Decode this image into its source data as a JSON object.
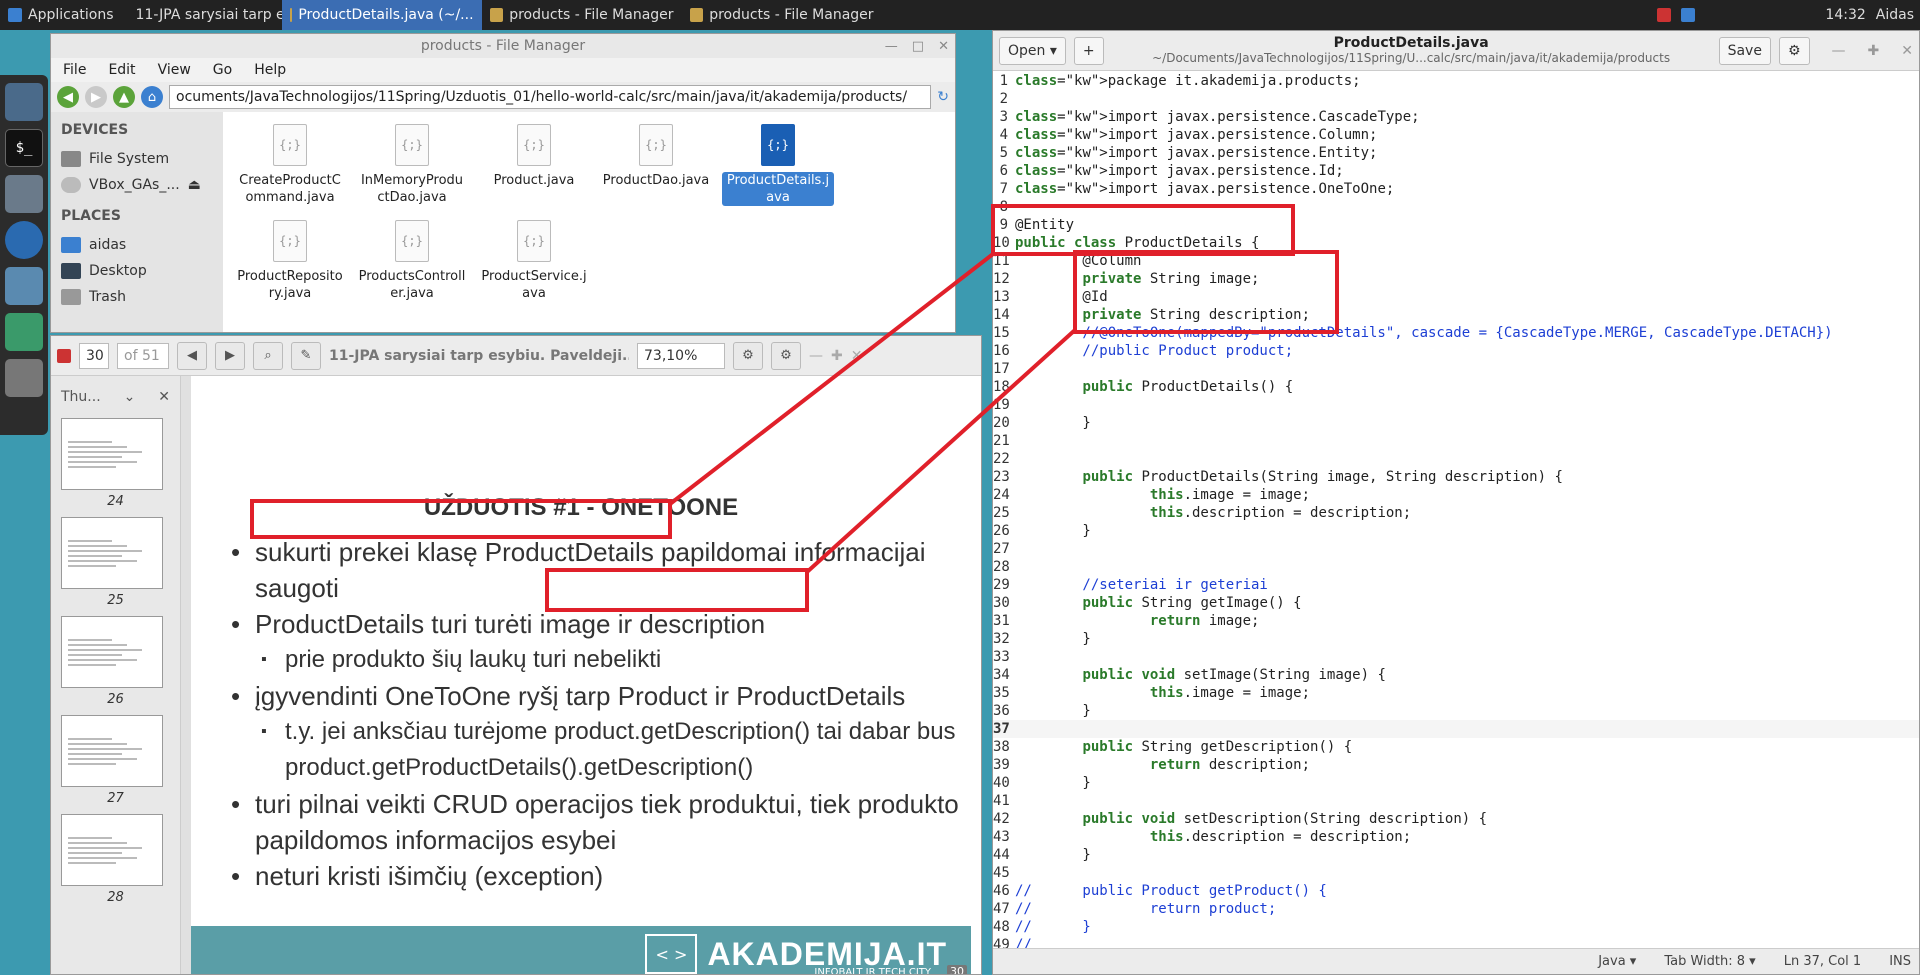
{
  "taskbar": {
    "apps_label": "Applications",
    "tasks": [
      {
        "label": "11-JPA sarysiai tarp es..."
      },
      {
        "label": "ProductDetails.java (~/..."
      },
      {
        "label": "products - File Manager"
      },
      {
        "label": "products - File Manager"
      }
    ],
    "clock": "14:32",
    "user": "Aidas"
  },
  "file_manager": {
    "title": "products - File Manager",
    "menu": [
      "File",
      "Edit",
      "View",
      "Go",
      "Help"
    ],
    "path": "ocuments/JavaTechnologijos/11Spring/Uzduotis_01/hello-world-calc/src/main/java/it/akademija/products/",
    "devices_head": "DEVICES",
    "devices": [
      "File System",
      "VBox_GAs_..."
    ],
    "places_head": "PLACES",
    "places": [
      "aidas",
      "Desktop",
      "Trash"
    ],
    "files": [
      "CreateProductCommand.java",
      "InMemoryProductDao.java",
      "Product.java",
      "ProductDao.java",
      "ProductDetails.java",
      "ProductRepository.java",
      "ProductsController.java",
      "ProductService.java"
    ],
    "selected_file": "ProductDetails.java"
  },
  "pdf_viewer": {
    "page_input": "30",
    "page_total": "of 51",
    "doc_title": "11-JPA sarysiai tarp esybiu. Paveldeji...",
    "zoom": "73,10%",
    "thumbs_label": "Thu...",
    "thumb_numbers": [
      "24",
      "25",
      "26",
      "27",
      "28"
    ],
    "slide": {
      "title": "UŽDUOTIS #1 - ONETOONE",
      "b1": "sukurti prekei klasę ProductDetails papildomai informacijai saugoti",
      "b2": "ProductDetails turi turėti image ir description",
      "b2a": "prie produkto šių laukų turi nebelikti",
      "b3": "įgyvendinti OneToOne ryšį tarp Product ir ProductDetails",
      "b3a": "t.y. jei anksčiau turėjome product.getDescription() tai dabar bus product.getProductDetails().getDescription()",
      "b4": "turi pilnai veikti CRUD operacijos tiek produktui, tiek produkto papildomos informacijos esybei",
      "b5": "neturi kristi išimčių (exception)",
      "logo": "AKADEMIJA.IT",
      "logo_sub": "INFOBALT IR TECH CITY",
      "page_badge": "30"
    }
  },
  "editor": {
    "open_label": "Open",
    "new_label": "+",
    "title": "ProductDetails.java",
    "subtitle": "~/Documents/JavaTechnologijos/11Spring/U...calc/src/main/java/it/akademija/products",
    "save_label": "Save",
    "status_lang": "Java",
    "status_tab": "Tab Width: 8",
    "status_pos": "Ln 37, Col 1",
    "status_mode": "INS",
    "current_line": 37,
    "lines": [
      "package it.akademija.products;",
      "",
      "import javax.persistence.CascadeType;",
      "import javax.persistence.Column;",
      "import javax.persistence.Entity;",
      "import javax.persistence.Id;",
      "import javax.persistence.OneToOne;",
      "",
      "@Entity",
      "public class ProductDetails {",
      "        @Column",
      "        private String image;",
      "        @Id",
      "        private String description;",
      "        //@OneToOne(mappedBy=\"productDetails\", cascade = {CascadeType.MERGE, CascadeType.DETACH})",
      "        //public Product product;",
      "",
      "        public ProductDetails() {",
      "",
      "        }",
      "",
      "",
      "        public ProductDetails(String image, String description) {",
      "                this.image = image;",
      "                this.description = description;",
      "        }",
      "",
      "",
      "        //seteriai ir geteriai",
      "        public String getImage() {",
      "                return image;",
      "        }",
      "",
      "        public void setImage(String image) {",
      "                this.image = image;",
      "        }",
      "",
      "        public String getDescription() {",
      "                return description;",
      "        }",
      "",
      "        public void setDescription(String description) {",
      "                this.description = description;",
      "        }",
      "",
      "//      public Product getProduct() {",
      "//              return product;",
      "//      }",
      "//"
    ]
  },
  "colors": {
    "highlight": "#e0202a",
    "desktop": "#3c9ab0",
    "selection": "#3b80d0"
  }
}
